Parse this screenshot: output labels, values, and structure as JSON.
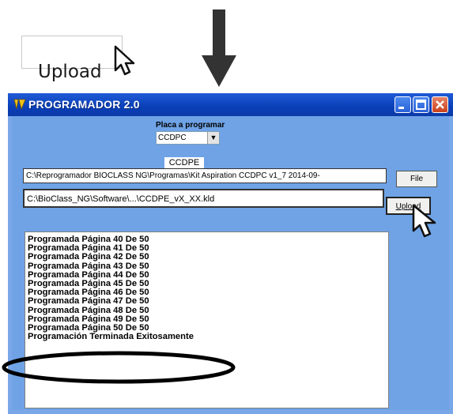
{
  "annotation": {
    "upload_label": "Upload"
  },
  "window": {
    "title": "PROGRAMADOR 2.0"
  },
  "placa": {
    "label": "Placa a programar",
    "selected": "CCDPC"
  },
  "ccdpe_label": "CCDPE",
  "paths": {
    "config_path": "C:\\Reprogramador BIOCLASS NG\\Programas\\Kit Aspiration CCDPC v1_7 2014-09-",
    "firmware_path": "C:\\BioClass_NG\\Software\\...\\CCDPE_vX_XX.kld"
  },
  "buttons": {
    "file": "File",
    "upload": "Upload"
  },
  "log": [
    "Programada Página 40 De 50",
    "Programada Página 41 De 50",
    "Programada Página 42 De 50",
    "Programada Página 43 De 50",
    "Programada Página 44 De 50",
    "Programada Página 45 De 50",
    "Programada Página 46 De 50",
    "Programada Página 47 De 50",
    "Programada Página 48 De 50",
    "Programada Página 49 De 50",
    "Programada Página 50 De 50",
    "Programación Terminada Exitosamente"
  ],
  "colors": {
    "titlebar": "#0a3fb8",
    "window_bg": "#6fa3e6",
    "close_button": "#c9401b",
    "highlight_ellipse": "#000000"
  }
}
